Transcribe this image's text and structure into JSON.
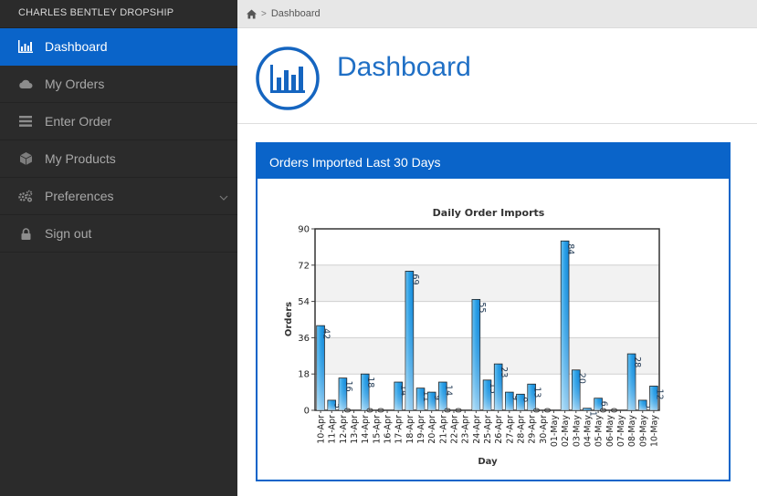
{
  "brand": "CHARLES BENTLEY DROPSHIP",
  "sidebar": {
    "items": [
      {
        "label": "Dashboard",
        "icon": "bar-chart-icon",
        "active": true
      },
      {
        "label": "My Orders",
        "icon": "cloud-icon"
      },
      {
        "label": "Enter Order",
        "icon": "list-icon"
      },
      {
        "label": "My Products",
        "icon": "cube-icon"
      },
      {
        "label": "Preferences",
        "icon": "cogs-icon",
        "has_submenu": true
      },
      {
        "label": "Sign out",
        "icon": "lock-icon"
      }
    ]
  },
  "breadcrumb": {
    "current": "Dashboard"
  },
  "header": {
    "title": "Dashboard"
  },
  "panel": {
    "title": "Orders Imported Last 30 Days"
  },
  "colors": {
    "accent": "#0a64c9",
    "sidebar_bg": "#2b2b2b",
    "title": "#1f6fc5"
  },
  "chart_data": {
    "type": "bar",
    "title": "Daily Order Imports",
    "xlabel": "Day",
    "ylabel": "Orders",
    "ylim": [
      0,
      90
    ],
    "yticks": [
      0,
      18,
      36,
      54,
      72,
      90
    ],
    "grid": true,
    "categories": [
      "10-Apr",
      "11-Apr",
      "12-Apr",
      "13-Apr",
      "14-Apr",
      "15-Apr",
      "16-Apr",
      "17-Apr",
      "18-Apr",
      "19-Apr",
      "20-Apr",
      "21-Apr",
      "22-Apr",
      "23-Apr",
      "24-Apr",
      "25-Apr",
      "26-Apr",
      "27-Apr",
      "28-Apr",
      "29-Apr",
      "30-Apr",
      "01-May",
      "02-May",
      "03-May",
      "04-May",
      "05-May",
      "06-May",
      "07-May",
      "08-May",
      "09-May",
      "10-May"
    ],
    "values": [
      42,
      5,
      16,
      0,
      18,
      0,
      0,
      14,
      69,
      11,
      9,
      14,
      0,
      0,
      55,
      15,
      23,
      9,
      8,
      13,
      0,
      0,
      84,
      20,
      1,
      6,
      0,
      0,
      28,
      5,
      12
    ]
  }
}
